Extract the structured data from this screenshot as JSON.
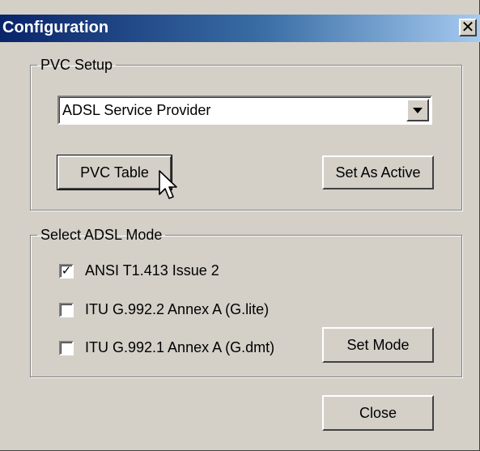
{
  "window": {
    "title": "Configuration",
    "close_glyph": "✕"
  },
  "pvc_setup": {
    "legend": "PVC Setup",
    "provider_select": {
      "selected": "ADSL Service Provider"
    },
    "pvc_table_label": "PVC Table",
    "set_active_label": "Set As Active"
  },
  "adsl_mode": {
    "legend": "Select ADSL Mode",
    "options": [
      {
        "label": "ANSI T1.413 Issue 2",
        "checked": true,
        "mark": "✓"
      },
      {
        "label": "ITU G.992.2 Annex A (G.lite)",
        "checked": false,
        "mark": ""
      },
      {
        "label": "ITU G.992.1 Annex A (G.dmt)",
        "checked": false,
        "mark": ""
      }
    ],
    "set_mode_label": "Set Mode"
  },
  "footer": {
    "close_label": "Close"
  },
  "icons": {
    "cursor": "arrow-pointer",
    "dropdown": "chevron-down",
    "close": "x"
  },
  "colors": {
    "titlebar_start": "#0a246a",
    "titlebar_end": "#a6caf0",
    "face": "#d4d0c8"
  }
}
